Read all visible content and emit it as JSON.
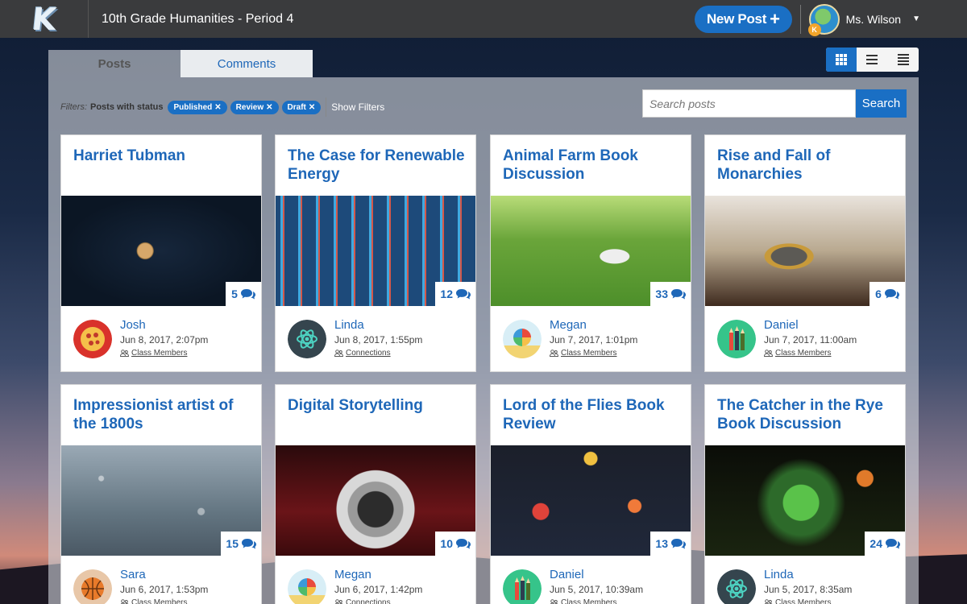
{
  "header": {
    "class_title": "10th Grade Humanities - Period 4",
    "new_post_label": "New Post",
    "user_name": "Ms. Wilson"
  },
  "tabs": [
    {
      "label": "Posts",
      "active": true
    },
    {
      "label": "Comments",
      "active": false
    }
  ],
  "view_modes": [
    "grid-icon",
    "list-icon",
    "detail-list-icon"
  ],
  "filters": {
    "label": "Filters:",
    "status_label": "Posts with status",
    "chips": [
      "Published",
      "Review",
      "Draft"
    ],
    "show_filters": "Show Filters"
  },
  "search": {
    "placeholder": "Search posts",
    "button_label": "Search"
  },
  "posts": [
    {
      "title": "Harriet Tubman",
      "comments": "5",
      "author": "Josh",
      "date": "Jun 8, 2017, 2:07pm",
      "audience": "Class Members",
      "avatar": "pizza"
    },
    {
      "title": "The Case for Renewable Energy",
      "comments": "12",
      "author": "Linda",
      "date": "Jun 8, 2017, 1:55pm",
      "audience": "Connections",
      "avatar": "atom"
    },
    {
      "title": "Animal Farm Book Discussion",
      "comments": "33",
      "author": "Megan",
      "date": "Jun 7, 2017, 1:01pm",
      "audience": "Class Members",
      "avatar": "beach-ball"
    },
    {
      "title": "Rise and Fall of Monarchies",
      "comments": "6",
      "author": "Daniel",
      "date": "Jun 7, 2017, 11:00am",
      "audience": "Class Members",
      "avatar": "pencils"
    },
    {
      "title": "Impressionist artist of the 1800s",
      "comments": "15",
      "author": "Sara",
      "date": "Jun 6, 2017, 1:53pm",
      "audience": "Class Members",
      "avatar": "basketball"
    },
    {
      "title": "Digital Storytelling",
      "comments": "10",
      "author": "Megan",
      "date": "Jun 6, 2017, 1:42pm",
      "audience": "Connections",
      "avatar": "beach-ball"
    },
    {
      "title": "Lord of the Flies Book Review",
      "comments": "13",
      "author": "Daniel",
      "date": "Jun 5, 2017, 10:39am",
      "audience": "Class Members",
      "avatar": "pencils"
    },
    {
      "title": "The Catcher in the Rye Book Discussion",
      "comments": "24",
      "author": "Linda",
      "date": "Jun 5, 2017, 8:35am",
      "audience": "Class Members",
      "avatar": "atom"
    }
  ],
  "colors": {
    "accent": "#1a6fc4",
    "link": "#1e67b8",
    "topbar": "#3a3b3d"
  }
}
